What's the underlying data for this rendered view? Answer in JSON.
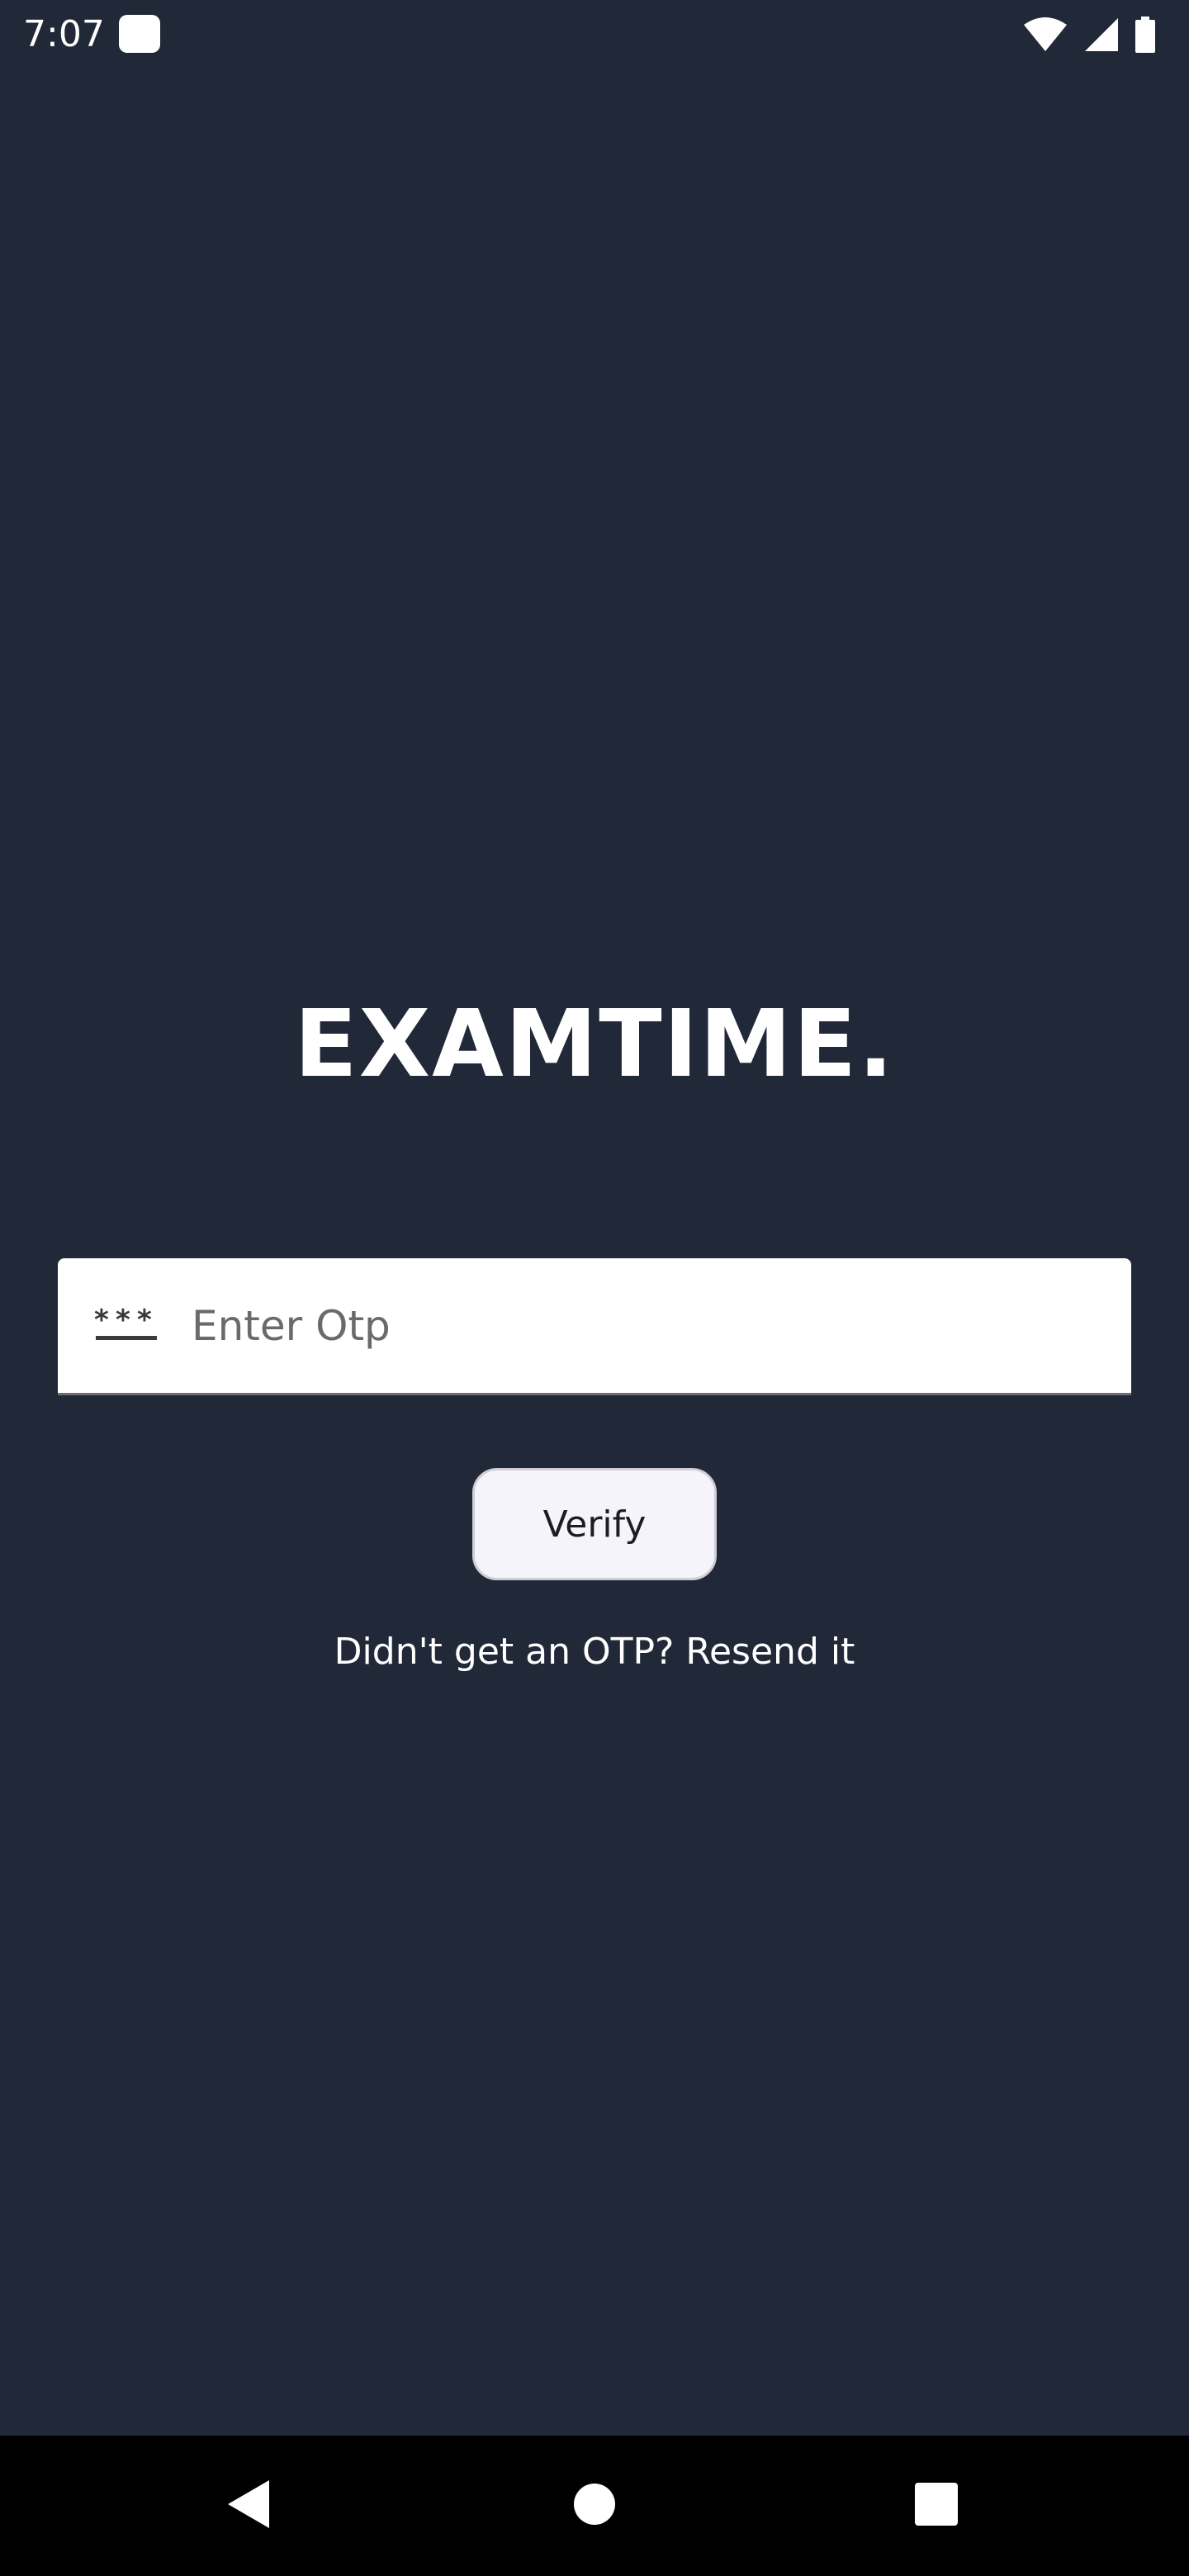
{
  "status_bar": {
    "time": "7:07"
  },
  "logo": {
    "text": "EXAMTIME."
  },
  "otp_field": {
    "placeholder": "Enter Otp",
    "value": "",
    "icon": "password-icon"
  },
  "verify_button": {
    "label": "Verify"
  },
  "resend": {
    "prompt": "Didn't get an OTP?",
    "link": "Resend it"
  },
  "nav_bar": {
    "back_icon": "back-icon",
    "home_icon": "home-icon",
    "recents_icon": "recents-icon"
  },
  "colors": {
    "background": "#212938",
    "field_background": "#ffffff",
    "button_background": "#f6f4fb",
    "text_primary": "#ffffff",
    "nav_background": "#000000"
  }
}
